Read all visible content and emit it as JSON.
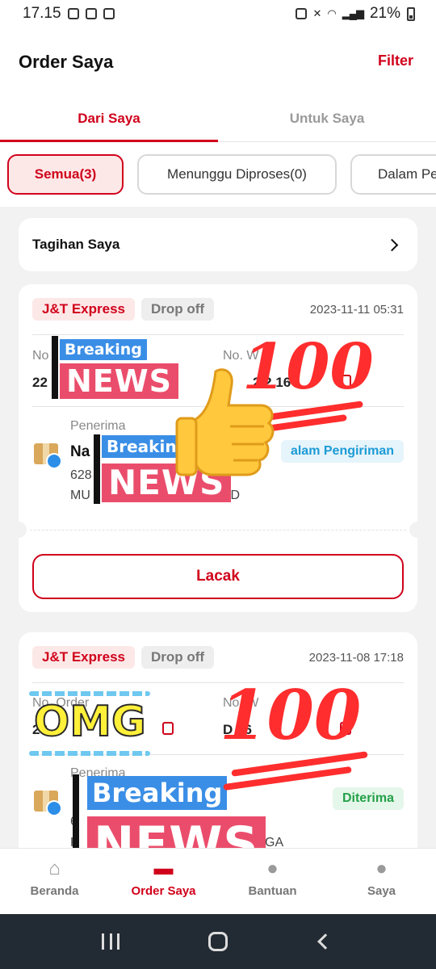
{
  "status_bar": {
    "time": "17.15",
    "battery": "21%"
  },
  "header": {
    "title": "Order Saya",
    "filter_label": "Filter"
  },
  "tabs": [
    {
      "label": "Dari Saya",
      "active": true
    },
    {
      "label": "Untuk Saya",
      "active": false
    }
  ],
  "chips": [
    {
      "label": "Semua(3)",
      "active": true
    },
    {
      "label": "Menunggu Diproses(0)",
      "active": false
    },
    {
      "label": "Dalam Pe",
      "active": false
    }
  ],
  "bill": {
    "label": "Tagihan Saya"
  },
  "orders": [
    {
      "courier": "J&T Express",
      "method": "Drop off",
      "date": "2023-11-11 05:31",
      "order_label": "No",
      "order_value": "22",
      "waybill_label": "No. W",
      "waybill_value": "2 2 16",
      "recipient_label": "Penerima",
      "recipient_name": "Na",
      "recipient_phone": "628",
      "recipient_addr_start": "MU",
      "recipient_addr_end": "ID",
      "status": "alam Pengiriman",
      "track_label": "Lacak"
    },
    {
      "courier": "J&T Express",
      "method": "Drop off",
      "date": "2023-11-08 17:18",
      "order_label": "No. Order",
      "order_value": "23",
      "waybill_label": "No. W",
      "waybill_value": "D 26",
      "recipient_label": "Penerima",
      "recipient_name": "",
      "recipient_phone": "6",
      "recipient_addr_start": "K",
      "recipient_addr_end": "GA",
      "status": "Diterima"
    }
  ],
  "bottom_nav": [
    {
      "label": "Beranda",
      "icon": "home-icon",
      "active": false
    },
    {
      "label": "Order Saya",
      "icon": "orders-icon",
      "active": true
    },
    {
      "label": "Bantuan",
      "icon": "help-icon",
      "active": false
    },
    {
      "label": "Saya",
      "icon": "profile-icon",
      "active": false
    }
  ],
  "stickers": {
    "breaking": "Breaking",
    "news": "NEWS",
    "hundred": "100",
    "omg": "OMG"
  },
  "colors": {
    "accent": "#d0021b",
    "shipping": "#1c9bd6",
    "delivered": "#24a148"
  }
}
